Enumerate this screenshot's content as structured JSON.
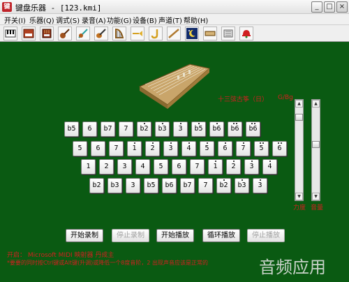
{
  "window": {
    "title": "键盘乐器 - [123.kmi]",
    "app_icon": "键",
    "min_glyph": "_",
    "max_glyph": "□",
    "close_glyph": "×"
  },
  "menu": [
    "开关(I)",
    "乐器(Q)",
    "调式(S)",
    "录音(A)",
    "功能(G)",
    "设备(B)",
    "声道(T)",
    "帮助(H)"
  ],
  "toolbar": {
    "icons": [
      "piano-icon",
      "keyboard-icon",
      "organ-icon",
      "guitar-icon",
      "violin-icon",
      "bass-guitar-icon",
      "harp-icon",
      "trumpet-icon",
      "saxophone-icon",
      "flute-icon",
      "night-icon",
      "guzheng-icon",
      "drum-icon",
      "bell-icon"
    ]
  },
  "instrument": {
    "name": "十三弦古筝（日）",
    "key": "G/Bg"
  },
  "keyboard": {
    "row1": [
      {
        "note": "b5",
        "dots_up": 0,
        "dots_down": 0
      },
      {
        "note": "6",
        "dots_up": 0,
        "dots_down": 0
      },
      {
        "note": "b7",
        "dots_up": 0,
        "dots_down": 0
      },
      {
        "note": "7",
        "dots_up": 0,
        "dots_down": 0
      },
      {
        "note": "b2",
        "dots_up": 1,
        "dots_down": 0
      },
      {
        "note": "b3",
        "dots_up": 1,
        "dots_down": 0
      },
      {
        "note": "3",
        "dots_up": 1,
        "dots_down": 0
      },
      {
        "note": "b5",
        "dots_up": 1,
        "dots_down": 0
      },
      {
        "note": "b6",
        "dots_up": 1,
        "dots_down": 0
      },
      {
        "note": "b6",
        "dots_up": 2,
        "dots_down": 0
      },
      {
        "note": "b6",
        "dots_up": 2,
        "dots_down": 0
      }
    ],
    "row2": [
      {
        "note": "5",
        "dots_up": 0,
        "dots_down": 0
      },
      {
        "note": "6",
        "dots_up": 0,
        "dots_down": 0
      },
      {
        "note": "7",
        "dots_up": 0,
        "dots_down": 0
      },
      {
        "note": "1",
        "dots_up": 1,
        "dots_down": 0
      },
      {
        "note": "2",
        "dots_up": 1,
        "dots_down": 0
      },
      {
        "note": "3",
        "dots_up": 1,
        "dots_down": 0
      },
      {
        "note": "4",
        "dots_up": 1,
        "dots_down": 0
      },
      {
        "note": "5",
        "dots_up": 1,
        "dots_down": 0
      },
      {
        "note": "6",
        "dots_up": 1,
        "dots_down": 0
      },
      {
        "note": "7",
        "dots_up": 1,
        "dots_down": 0
      },
      {
        "note": "5",
        "dots_up": 2,
        "dots_down": 0
      },
      {
        "note": "6",
        "dots_up": 2,
        "dots_down": 0
      }
    ],
    "row3": [
      {
        "note": "1",
        "dots_up": 0,
        "dots_down": 0
      },
      {
        "note": "2",
        "dots_up": 0,
        "dots_down": 0
      },
      {
        "note": "3",
        "dots_up": 0,
        "dots_down": 0
      },
      {
        "note": "4",
        "dots_up": 0,
        "dots_down": 0
      },
      {
        "note": "5",
        "dots_up": 0,
        "dots_down": 0
      },
      {
        "note": "6",
        "dots_up": 0,
        "dots_down": 0
      },
      {
        "note": "7",
        "dots_up": 0,
        "dots_down": 0
      },
      {
        "note": "1",
        "dots_up": 1,
        "dots_down": 0
      },
      {
        "note": "2",
        "dots_up": 1,
        "dots_down": 0
      },
      {
        "note": "3",
        "dots_up": 1,
        "dots_down": 0
      },
      {
        "note": "4",
        "dots_up": 1,
        "dots_down": 0
      }
    ],
    "row4": [
      {
        "note": "b2",
        "dots_up": 0,
        "dots_down": 0
      },
      {
        "note": "b3",
        "dots_up": 0,
        "dots_down": 0
      },
      {
        "note": "3",
        "dots_up": 0,
        "dots_down": 0
      },
      {
        "note": "b5",
        "dots_up": 0,
        "dots_down": 0
      },
      {
        "note": "b6",
        "dots_up": 0,
        "dots_down": 0
      },
      {
        "note": "b7",
        "dots_up": 0,
        "dots_down": 0
      },
      {
        "note": "7",
        "dots_up": 0,
        "dots_down": 0
      },
      {
        "note": "b2",
        "dots_up": 1,
        "dots_down": 0
      },
      {
        "note": "b3",
        "dots_up": 1,
        "dots_down": 0
      },
      {
        "note": "3",
        "dots_up": 1,
        "dots_down": 0
      }
    ]
  },
  "sliders": {
    "left_label": "力度",
    "right_label": "音量",
    "left_level": 0.08,
    "right_level": 0.43
  },
  "controls": {
    "start_record": "开始录制",
    "stop_record": "停止录制",
    "start_play": "开始播放",
    "loop_play": "循环播放",
    "stop_play": "停止播放"
  },
  "status": {
    "line1": "开启： Microsoft MIDI 映射器     丹成主",
    "line2": "*要要的同时按Ctrl键或Alt键(升调)或降低一个8度音阶，2 出现声音应该是正常的"
  },
  "watermark": "音频应用",
  "colors": {
    "background": "#0a5a12",
    "accent_text": "#d22020"
  }
}
